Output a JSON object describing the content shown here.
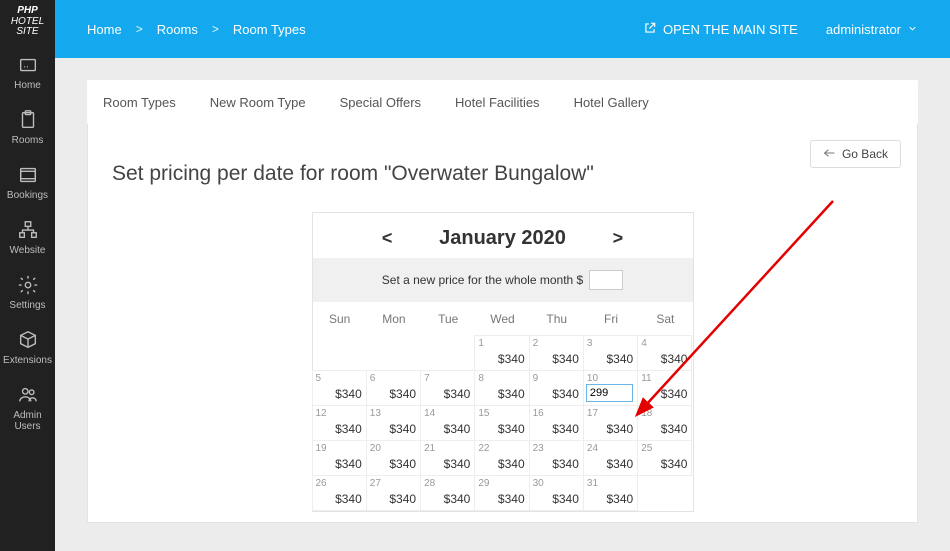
{
  "brand": {
    "l1": "PHP",
    "l2": "HOTEL",
    "l3": "SITE"
  },
  "sidebar": {
    "items": [
      {
        "label": "Home"
      },
      {
        "label": "Rooms"
      },
      {
        "label": "Bookings"
      },
      {
        "label": "Website"
      },
      {
        "label": "Settings"
      },
      {
        "label": "Extensions"
      },
      {
        "label": "Admin Users"
      }
    ]
  },
  "breadcrumb": {
    "items": [
      "Home",
      "Rooms",
      "Room Types"
    ],
    "sep": ">"
  },
  "topbar": {
    "open_site": "OPEN THE MAIN SITE",
    "user": "administrator"
  },
  "tabs": [
    {
      "label": "Room Types"
    },
    {
      "label": "New Room Type"
    },
    {
      "label": "Special Offers"
    },
    {
      "label": "Hotel Facilities"
    },
    {
      "label": "Hotel Gallery"
    }
  ],
  "buttons": {
    "go_back": "Go Back"
  },
  "page_title": "Set pricing per date for room \"Overwater Bungalow\"",
  "calendar": {
    "prev": "<",
    "next": ">",
    "month_label": "January 2020",
    "set_row_label": "Set a new price for the whole month $",
    "set_row_value": "",
    "day_headers": [
      "Sun",
      "Mon",
      "Tue",
      "Wed",
      "Thu",
      "Fri",
      "Sat"
    ],
    "editing_value": "299",
    "weeks": [
      [
        {
          "blank": true
        },
        {
          "blank": true
        },
        {
          "blank": true
        },
        {
          "d": 1,
          "p": "$340"
        },
        {
          "d": 2,
          "p": "$340"
        },
        {
          "d": 3,
          "p": "$340"
        },
        {
          "d": 4,
          "p": "$340"
        }
      ],
      [
        {
          "d": 5,
          "p": "$340"
        },
        {
          "d": 6,
          "p": "$340"
        },
        {
          "d": 7,
          "p": "$340"
        },
        {
          "d": 8,
          "p": "$340"
        },
        {
          "d": 9,
          "p": "$340"
        },
        {
          "d": 10,
          "editing": true
        },
        {
          "d": 11,
          "p": "$340"
        }
      ],
      [
        {
          "d": 12,
          "p": "$340"
        },
        {
          "d": 13,
          "p": "$340"
        },
        {
          "d": 14,
          "p": "$340"
        },
        {
          "d": 15,
          "p": "$340"
        },
        {
          "d": 16,
          "p": "$340"
        },
        {
          "d": 17,
          "p": "$340"
        },
        {
          "d": 18,
          "p": "$340"
        }
      ],
      [
        {
          "d": 19,
          "p": "$340"
        },
        {
          "d": 20,
          "p": "$340"
        },
        {
          "d": 21,
          "p": "$340"
        },
        {
          "d": 22,
          "p": "$340"
        },
        {
          "d": 23,
          "p": "$340"
        },
        {
          "d": 24,
          "p": "$340"
        },
        {
          "d": 25,
          "p": "$340"
        }
      ],
      [
        {
          "d": 26,
          "p": "$340"
        },
        {
          "d": 27,
          "p": "$340"
        },
        {
          "d": 28,
          "p": "$340"
        },
        {
          "d": 29,
          "p": "$340"
        },
        {
          "d": 30,
          "p": "$340"
        },
        {
          "d": 31,
          "p": "$340"
        },
        {
          "blank": true
        }
      ]
    ]
  }
}
